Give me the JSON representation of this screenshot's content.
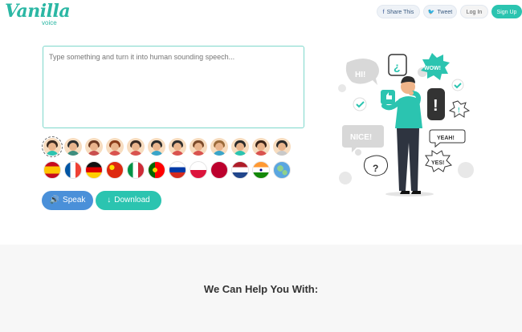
{
  "brand": {
    "name": "Vanilla",
    "sub": "voice",
    "color": "#2bb7a4"
  },
  "header": {
    "share_label": "Share This",
    "tweet_label": "Tweet",
    "login_label": "Log In",
    "signup_label": "Sign Up"
  },
  "editor": {
    "placeholder": "Type something and turn it into human sounding speech..."
  },
  "voices": [
    {
      "name": "voice-1",
      "hair": "#3b2a20",
      "shirt": "#2bc4b0",
      "selected": true
    },
    {
      "name": "voice-2",
      "hair": "#2e2e2e",
      "shirt": "#3e8e7e"
    },
    {
      "name": "voice-3",
      "hair": "#6b3a22",
      "shirt": "#c94f4f"
    },
    {
      "name": "voice-4",
      "hair": "#8a3c1a",
      "shirt": "#d9534f"
    },
    {
      "name": "voice-5",
      "hair": "#3a2a22",
      "shirt": "#d9534f"
    },
    {
      "name": "voice-6",
      "hair": "#2a2a2a",
      "shirt": "#3aa5c9"
    },
    {
      "name": "voice-7",
      "hair": "#2e2e2e",
      "shirt": "#d9534f"
    },
    {
      "name": "voice-8",
      "hair": "#7a4a2a",
      "shirt": "#d9534f"
    },
    {
      "name": "voice-9",
      "hair": "#9a6a3a",
      "shirt": "#3aa5c9"
    },
    {
      "name": "voice-10",
      "hair": "#2a2a2a",
      "shirt": "#2bc4b0"
    },
    {
      "name": "voice-11",
      "hair": "#3a2418",
      "shirt": "#d9534f"
    },
    {
      "name": "voice-12",
      "hair": "#2a2a2a",
      "shirt": "#c9c9c9"
    }
  ],
  "languages": [
    {
      "name": "spanish-flag"
    },
    {
      "name": "french-flag"
    },
    {
      "name": "german-flag"
    },
    {
      "name": "chinese-flag"
    },
    {
      "name": "italian-flag"
    },
    {
      "name": "portuguese-flag"
    },
    {
      "name": "russian-flag"
    },
    {
      "name": "polish-flag"
    },
    {
      "name": "japanese-flag"
    },
    {
      "name": "dutch-flag"
    },
    {
      "name": "indian-flag"
    },
    {
      "name": "globe-icon"
    }
  ],
  "actions": {
    "speak_label": "Speak",
    "download_label": "Download"
  },
  "illustration": {
    "bubbles": [
      "HI!",
      "¿",
      "WOW!",
      "!",
      "NICE!",
      "YEAH!",
      "?",
      "YES!"
    ]
  },
  "section": {
    "title": "We Can Help You With:"
  },
  "colors": {
    "accent": "#2bc4b0",
    "speak": "#4a90d9"
  }
}
